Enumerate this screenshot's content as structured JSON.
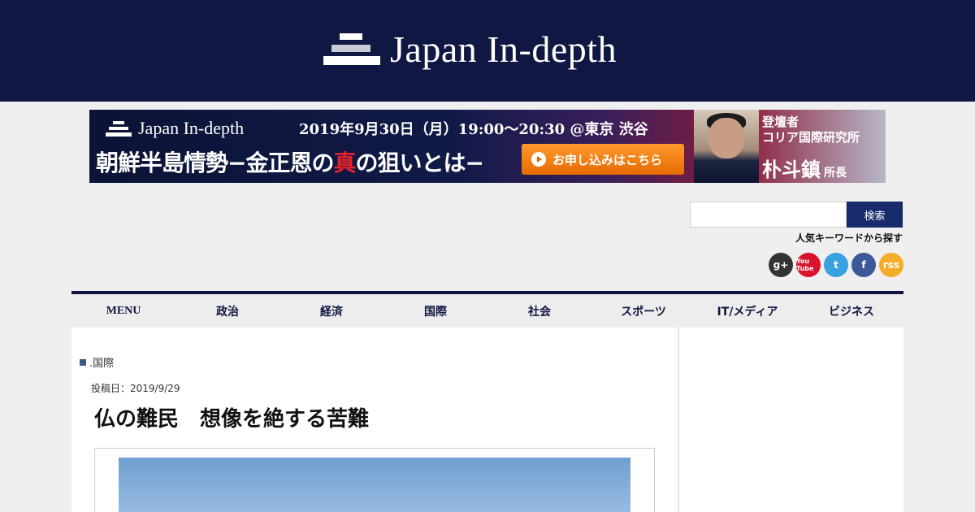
{
  "header": {
    "site_name": "Japan In-depth"
  },
  "banner": {
    "logo_text": "Japan In-depth",
    "date": "2019年9月30日（月）19:00～20:30 @東京 渋谷",
    "headline_pre": "朝鮮半島情勢−金正恩の",
    "headline_red": "真",
    "headline_post": "の狙いとは−",
    "cta": "お申し込みはこちら",
    "role_1": "登壇者",
    "role_2": "コリア国際研究所",
    "speaker": "朴斗鎮",
    "speaker_title": "所長"
  },
  "search": {
    "button": "検索",
    "value": "",
    "keyword_link": "人気キーワードから探す"
  },
  "social": {
    "google": "g+",
    "youtube": "You Tube",
    "twitter": "t",
    "facebook": "f",
    "rss": "rss"
  },
  "nav": [
    "MENU",
    "政治",
    "経済",
    "国際",
    "社会",
    "スポーツ",
    "IT/メディア",
    "ビジネス"
  ],
  "article": {
    "category": ".国際",
    "post_date": "投稿日：2019/9/29",
    "title": "仏の難民　想像を絶する苦難"
  }
}
